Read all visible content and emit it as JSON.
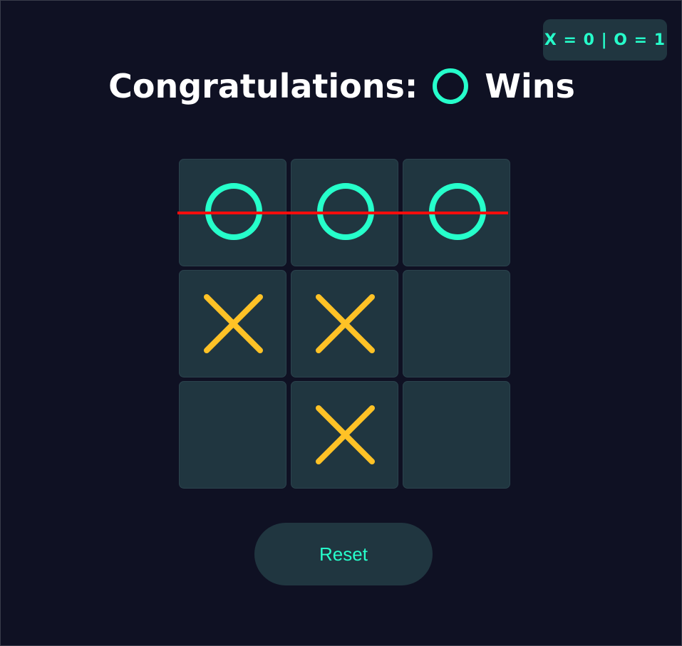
{
  "scoreboard": {
    "text": "X = 0 | O = 1"
  },
  "status": {
    "prefix": "Congratulations:",
    "winner_icon": "o-icon",
    "suffix": "Wins"
  },
  "board": {
    "cells": [
      "O",
      "O",
      "O",
      "X",
      "X",
      "",
      "",
      "X",
      ""
    ],
    "winning_line": "row-1"
  },
  "reset_label": "Reset",
  "colors": {
    "background": "#0f1123",
    "cell": "#203640",
    "o_mark": "#26ffcb",
    "x_mark": "#ffc226",
    "win_line": "#f50d0d",
    "title": "#ffffff"
  }
}
